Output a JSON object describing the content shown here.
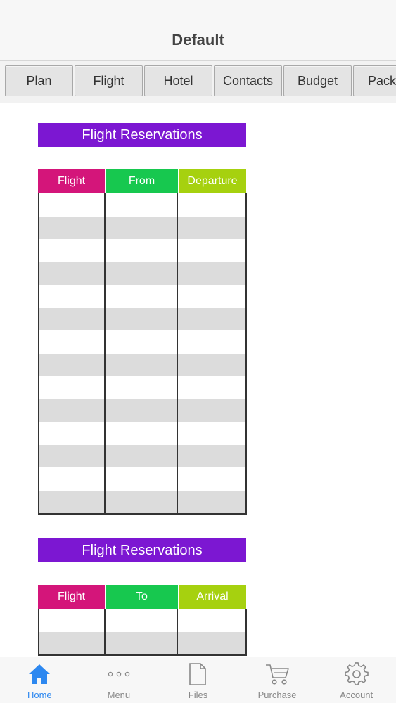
{
  "nav": {
    "title": "Default"
  },
  "segments": [
    "Plan",
    "Flight",
    "Hotel",
    "Contacts",
    "Budget",
    "Pack"
  ],
  "sections": [
    {
      "banner": "Flight Reservations",
      "headers": [
        {
          "label": "Flight",
          "color": "#d4157a"
        },
        {
          "label": "From",
          "color": "#17c84f"
        },
        {
          "label": "Departure",
          "color": "#a6d10f"
        }
      ],
      "row_count": 14
    },
    {
      "banner": "Flight Reservations",
      "headers": [
        {
          "label": "Flight",
          "color": "#d4157a"
        },
        {
          "label": "To",
          "color": "#17c84f"
        },
        {
          "label": "Arrival",
          "color": "#a6d10f"
        }
      ],
      "row_count": 2
    }
  ],
  "banner_color": "#7c17d2",
  "tabbar": {
    "items": [
      {
        "label": "Home",
        "icon": "home-icon",
        "active": true
      },
      {
        "label": "Menu",
        "icon": "more-icon",
        "active": false
      },
      {
        "label": "Files",
        "icon": "file-icon",
        "active": false
      },
      {
        "label": "Purchase",
        "icon": "cart-icon",
        "active": false
      },
      {
        "label": "Account",
        "icon": "gear-icon",
        "active": false
      }
    ],
    "active_color": "#2d88f0",
    "inactive_color": "#888888"
  }
}
